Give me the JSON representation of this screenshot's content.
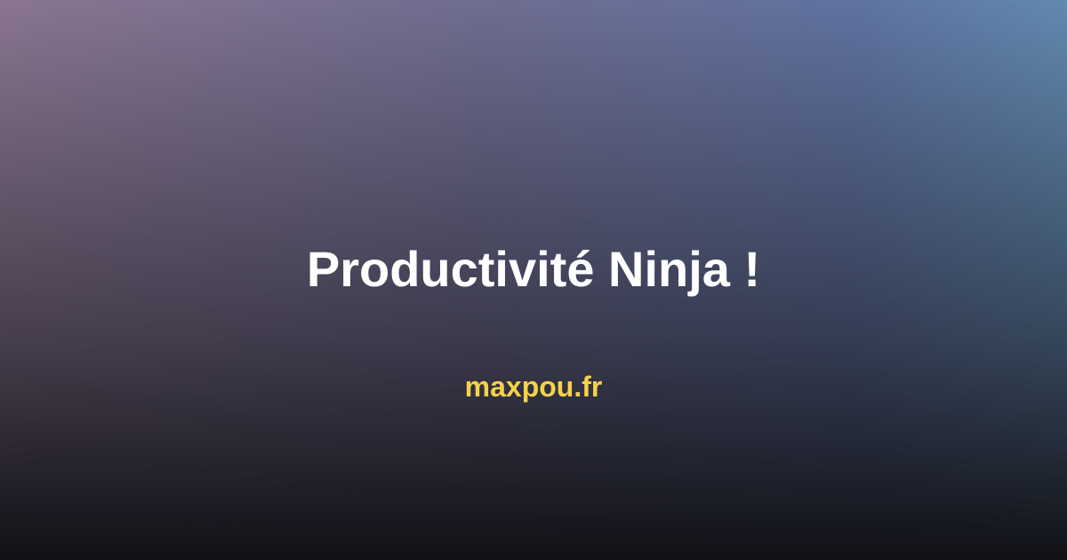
{
  "title": "Productivité Ninja !",
  "site": "maxpou.fr",
  "colors": {
    "title": "#ffffff",
    "site": "#f6d24a"
  }
}
